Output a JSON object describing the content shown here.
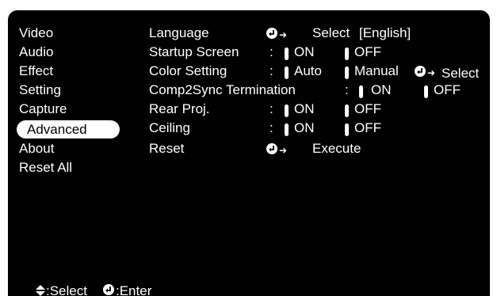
{
  "menu": [
    {
      "label": "Video"
    },
    {
      "label": "Audio"
    },
    {
      "label": "Effect"
    },
    {
      "label": "Setting"
    },
    {
      "label": "Capture"
    },
    {
      "label": "Advanced"
    },
    {
      "label": "About"
    },
    {
      "label": "Reset All"
    }
  ],
  "settings": {
    "language": {
      "label": "Language",
      "action": "Select",
      "value": "[English]"
    },
    "startup_screen": {
      "label": "Startup Screen",
      "sep": ":",
      "opt_on": "ON",
      "opt_off": "OFF"
    },
    "color_setting": {
      "label": "Color Setting",
      "sep": ":",
      "opt_auto": "Auto",
      "opt_manual": "Manual",
      "action": "Select"
    },
    "comp2sync": {
      "label": "Comp2Sync Termination",
      "sep": ":",
      "opt_on": "ON",
      "opt_off": "OFF"
    },
    "rear_proj": {
      "label": "Rear Proj.",
      "sep": ":",
      "opt_on": "ON",
      "opt_off": "OFF"
    },
    "ceiling": {
      "label": "Ceiling",
      "sep": ":",
      "opt_on": "ON",
      "opt_off": "OFF"
    },
    "reset": {
      "label": "Reset",
      "action": "Execute"
    }
  },
  "footer": {
    "select": ":Select",
    "enter": ":Enter"
  },
  "icons": {
    "enter": "enter-icon",
    "arrow": "arrow-right-icon",
    "updown": "up-down-icon"
  }
}
